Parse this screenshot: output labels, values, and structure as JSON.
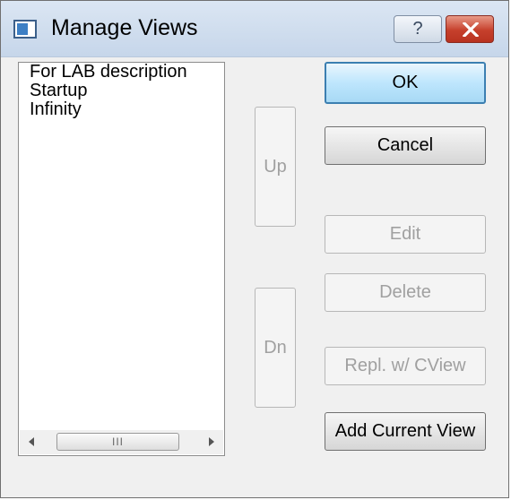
{
  "window": {
    "title": "Manage Views",
    "help_label": "?",
    "icon": "app-window-icon"
  },
  "views_list": {
    "items": [
      "For LAB description",
      "Startup",
      "Infinity"
    ],
    "scrollbar_thumb_grip": "III"
  },
  "buttons": {
    "ok": "OK",
    "cancel": "Cancel",
    "up": "Up",
    "dn": "Dn",
    "edit": "Edit",
    "delete": "Delete",
    "replace": "Repl. w/ CView",
    "add_current": "Add Current View"
  }
}
